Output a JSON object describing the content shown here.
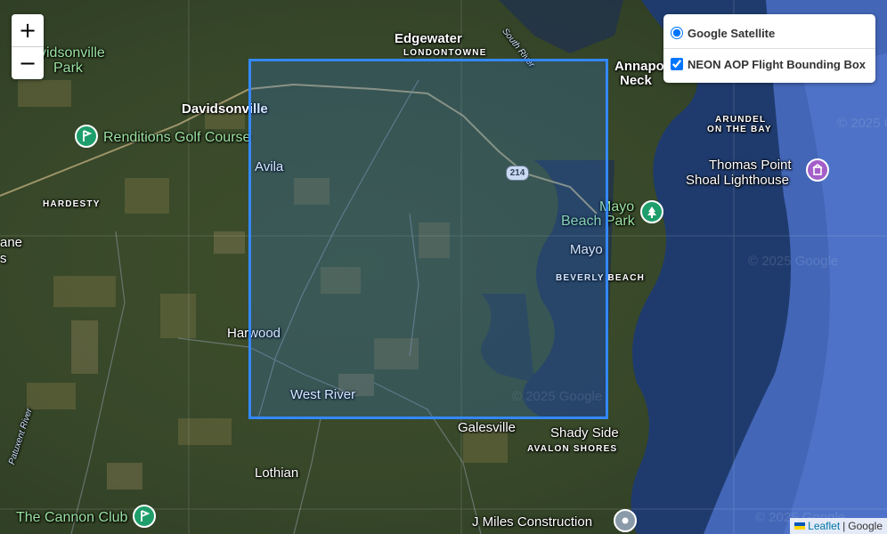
{
  "zoom": {
    "in_label": "+",
    "out_label": "−"
  },
  "layers": {
    "base": {
      "label": "Google Satellite",
      "checked": true
    },
    "overlay": {
      "label": "NEON AOP Flight Bounding Box",
      "checked": true
    }
  },
  "attribution": {
    "leaflet": "Leaflet",
    "separator": "|",
    "provider": "Google"
  },
  "colors": {
    "bbox": "#3388ff",
    "golf_poi": "#1e9e6a",
    "park_poi": "#1e9e6a",
    "lighthouse_poi": "#a45fc8",
    "construction_poi": "#8a9aa8"
  },
  "places": {
    "edgewater": "Edgewater",
    "londontowne": "LONDONTOWNE",
    "south_river": "South River",
    "annapolis": "Annapolis",
    "neck": "Neck",
    "davidsonville_park_1": "vidsonville",
    "davidsonville_park_2": "Park",
    "davidsonville": "Davidsonville",
    "renditions": "Renditions Golf Course",
    "avila": "Avila",
    "hardesty": "HARDESTY",
    "ane_1": "ane",
    "ane_2": "s",
    "arundel_1": "ARUNDEL",
    "arundel_2": "ON THE BAY",
    "thomas_point_1": "Thomas Point",
    "thomas_point_2": "Shoal Lighthouse",
    "mayo_beach_1": "Mayo",
    "mayo_beach_2": "Beach Park",
    "route": "214",
    "mayo": "Mayo",
    "beverly_beach": "BEVERLY BEACH",
    "harwood": "Harwood",
    "west_river": "West River",
    "galesville": "Galesville",
    "shady_side": "Shady Side",
    "avalon_shores": "AVALON SHORES",
    "patuxent_river": "Patuxent River",
    "lothian": "Lothian",
    "cannon_club": "The Cannon Club",
    "j_miles": "J Miles Construction"
  },
  "watermarks": [
    "© 2025 Google",
    "© 2025 Google",
    "© 2025 Google",
    "© 2025 Google"
  ]
}
